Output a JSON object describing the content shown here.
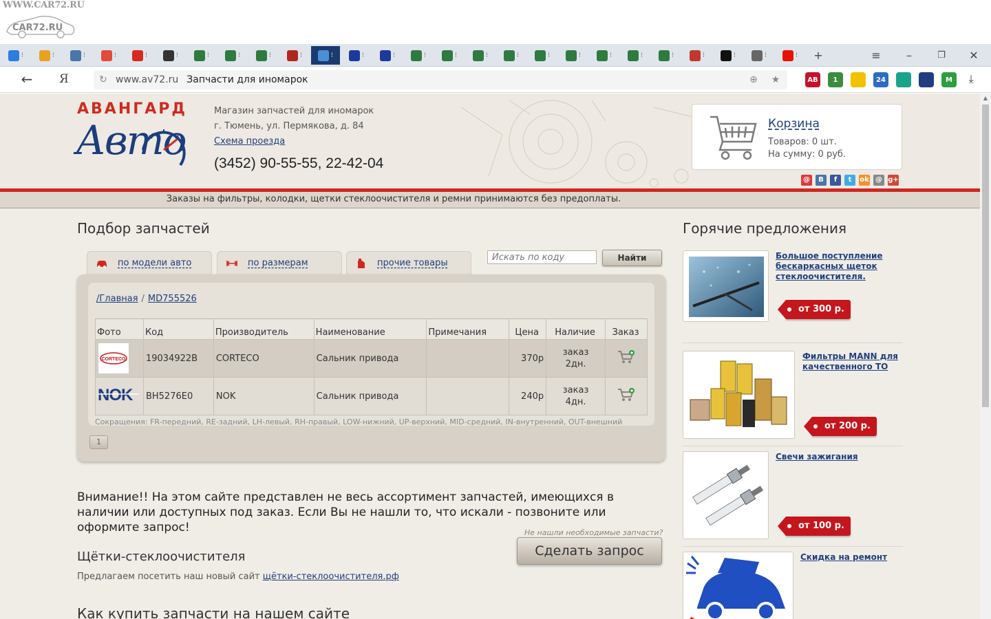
{
  "watermark": {
    "text": "WWW.CAR72.RU",
    "car_text": "CAR72.RU"
  },
  "browser": {
    "tabs": [
      {
        "icon": "globe-icon",
        "color": "#2a7de1"
      },
      {
        "icon": "mail-icon",
        "color": "#e8a221"
      },
      {
        "icon": "vk-icon",
        "color": "#4a76a8"
      },
      {
        "icon": "google-icon",
        "color": "#e04b3a"
      },
      {
        "icon": "flag-icon",
        "color": "#d52b1e"
      },
      {
        "icon": "car-icon",
        "color": "#333333"
      },
      {
        "icon": "car-icon",
        "color": "#2f7a3f"
      },
      {
        "icon": "car-icon",
        "color": "#2f7a3f"
      },
      {
        "icon": "car-icon",
        "color": "#2f7a3f"
      },
      {
        "icon": "tool-icon",
        "color": "#b3261e"
      },
      {
        "icon": "target-icon",
        "color": "#4a90d9",
        "active": true
      },
      {
        "icon": "letter-m-icon",
        "color": "#1c3a9e"
      },
      {
        "icon": "letter-m-icon",
        "color": "#1c3a9e"
      },
      {
        "icon": "car-icon",
        "color": "#2f7a3f"
      },
      {
        "icon": "car-icon",
        "color": "#2f7a3f"
      },
      {
        "icon": "car-icon",
        "color": "#2f7a3f"
      },
      {
        "icon": "car-icon",
        "color": "#2f7a3f"
      },
      {
        "icon": "car-icon",
        "color": "#2f7a3f"
      },
      {
        "icon": "car-icon",
        "color": "#2f7a3f"
      },
      {
        "icon": "car-icon",
        "color": "#2f7a3f"
      },
      {
        "icon": "car-icon",
        "color": "#2f7a3f"
      },
      {
        "icon": "car-icon",
        "color": "#2f7a3f"
      },
      {
        "icon": "puzzle-icon",
        "color": "#c0392b"
      },
      {
        "icon": "flag-icon",
        "color": "#111111"
      },
      {
        "icon": "page-icon",
        "color": "#666666"
      },
      {
        "icon": "yandex-icon",
        "color": "#e61400"
      }
    ],
    "url_host": "www.av72.ru",
    "url_title": "Запчасти для иномарок",
    "extensions": [
      {
        "icon": "adblock-icon",
        "color": "#c8102e",
        "label": "AB"
      },
      {
        "icon": "shield-icon",
        "color": "#3a8d3f",
        "label": "1"
      },
      {
        "icon": "bulb-icon",
        "color": "#f2c200",
        "label": ""
      },
      {
        "icon": "counter-icon",
        "color": "#2b6cc4",
        "label": "24"
      },
      {
        "icon": "camera-icon",
        "color": "#19a38c",
        "label": ""
      },
      {
        "icon": "download-icon",
        "color": "#1f3f7e",
        "label": ""
      },
      {
        "icon": "metro-icon",
        "color": "#2e9e3f",
        "label": "M"
      }
    ]
  },
  "header": {
    "logo_top": "АВАНГАРД",
    "logo_bottom": "Авто",
    "shop_desc": "Магазин запчастей для иномарок",
    "shop_addr": "г. Тюмень, ул. Пермякова, д. 84",
    "map_link": "Схема проезда",
    "phone": "(3452) 90-55-55, 22-42-04"
  },
  "cart": {
    "title": "Корзина",
    "items": "Товаров: 0 шт.",
    "sum": "На сумму: 0 руб."
  },
  "socials": [
    {
      "icon": "mail-ru-icon",
      "color": "#d93d3d",
      "label": "@"
    },
    {
      "icon": "vk-icon",
      "color": "#4a76a8",
      "label": "В"
    },
    {
      "icon": "facebook-icon",
      "color": "#3b5998",
      "label": "f"
    },
    {
      "icon": "twitter-icon",
      "color": "#41abe1",
      "label": "t"
    },
    {
      "icon": "odnoklassniki-icon",
      "color": "#f2922b",
      "label": "ok"
    },
    {
      "icon": "moimir-icon",
      "color": "#888888",
      "label": "@"
    },
    {
      "icon": "google-plus-icon",
      "color": "#d34836",
      "label": "g+"
    }
  ],
  "notice": "Заказы на фильтры, колодки, щетки стеклоочистителя и ремни принимаются без предоплаты.",
  "parts_selection": {
    "title": "Подбор запчастей",
    "tabs": [
      {
        "label": "по модели авто",
        "icon": "car-icon"
      },
      {
        "label": "по размерам",
        "icon": "ruler-icon"
      },
      {
        "label": "прочие товары",
        "icon": "canister-icon"
      }
    ],
    "search_placeholder": "Искать по коду",
    "search_button": "Найти",
    "breadcrumb": {
      "home": "/Главная",
      "current": "MD755526"
    },
    "columns": [
      "Фото",
      "Код",
      "Производитель",
      "Наименование",
      "Примечания",
      "Цена",
      "Наличие",
      "Заказ"
    ],
    "rows": [
      {
        "logo": "CORTECO",
        "code": "19034922B",
        "maker": "CORTECO",
        "name": "Сальник привода",
        "note": "",
        "price": "370р",
        "avail1": "заказ",
        "avail2": "2дн."
      },
      {
        "logo": "NOK",
        "code": "BH5276E0",
        "maker": "NOK",
        "name": "Сальник привода",
        "note": "",
        "price": "240р",
        "avail1": "заказ",
        "avail2": "4дн."
      }
    ],
    "abbreviations": "Сокращения: FR-передний, RE-задний, LH-левый, RH-правый, LOW-нижний, UP-верхний, MID-средний, IN-внутренний, OUT-внешний",
    "page": "1"
  },
  "attention": "Внимание!! На этом сайте представлен не весь ассортимент запчастей, имеющихся в наличии или доступных под заказ. Если Вы не нашли то, что искали - позвоните или оформите запрос!",
  "request": {
    "hint": "Не нашли необходимые запчасти?",
    "button": "Сделать запрос"
  },
  "wipers": {
    "title": "Щётки-стеклоочистителя",
    "text": "Предлагаем посетить наш новый сайт ",
    "link": "щётки-стеклоочистителя.рф"
  },
  "howto_title": "Как купить запчасти на нашем сайте",
  "hot": {
    "title": "Горячие предложения",
    "offers": [
      {
        "title": "Большое поступление бескаркасных щеток стеклоочистителя.",
        "price": "от 300 р."
      },
      {
        "title": "Фильтры MANN для качественного ТО",
        "price": "от 200 р."
      },
      {
        "title": "Свечи зажигания",
        "price": "от 100 р."
      },
      {
        "title": "Скидка на ремонт",
        "price": ""
      }
    ]
  },
  "colors": {
    "accent_red": "#d0281e",
    "brand_blue": "#1c3d7e",
    "link": "#1f3f7e",
    "page_bg": "#efece6"
  }
}
